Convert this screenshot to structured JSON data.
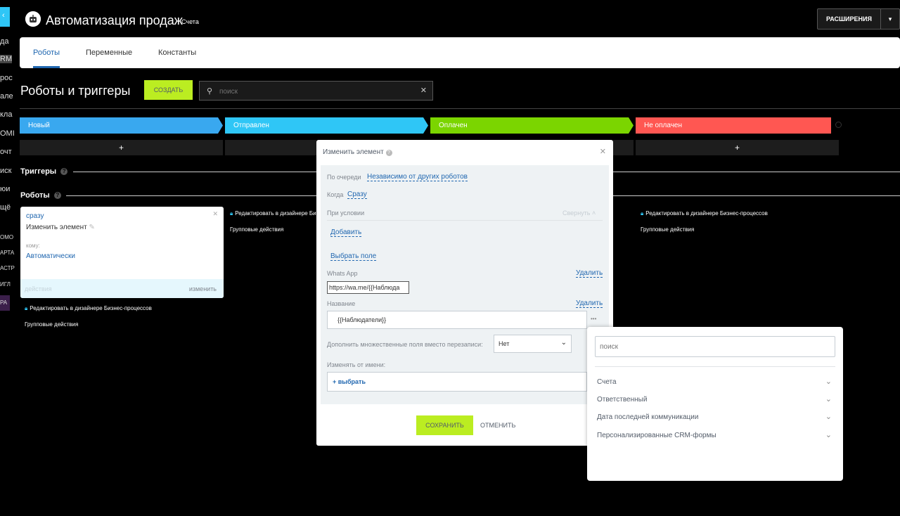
{
  "sidebar": {
    "items": [
      "да",
      "RM",
      "рос",
      "але",
      "кла",
      "ОМІ",
      "очт",
      "иск",
      "юи",
      "щё",
      "ОМО",
      "АРТА",
      "АСТР",
      "ИГЛ",
      "РА"
    ]
  },
  "header": {
    "title": "Автоматизация продаж",
    "subtitle": "Счета",
    "extensions_label": "РАСШИРЕНИЯ"
  },
  "tabs": [
    {
      "label": "Роботы"
    },
    {
      "label": "Переменные"
    },
    {
      "label": "Константы"
    }
  ],
  "page": {
    "title": "Роботы и триггеры",
    "create_label": "СОЗДАТЬ",
    "search_placeholder": "поиск"
  },
  "stages": [
    {
      "label": "Новый",
      "color": "#39a8ef"
    },
    {
      "label": "Отправлен",
      "color": "#2fc6f6"
    },
    {
      "label": "Оплачен",
      "color": "#7bd500"
    },
    {
      "label": "Не оплачен",
      "color": "#ff5752"
    }
  ],
  "sections": {
    "triggers": "Триггеры",
    "robots": "Роботы"
  },
  "robot_card": {
    "when": "сразу",
    "name": "Изменить элемент",
    "to_label": "кому:",
    "to_value": "Автоматически",
    "actions_label": "действия",
    "edit_label": "изменить"
  },
  "column_links": {
    "edit_designer": "Редактировать в дизайнере Бизнес-процессов",
    "group_actions": "Групповые действия",
    "edit_designer_truncated": "Редактировать в дизайнере Би"
  },
  "modal": {
    "title": "Изменить элемент",
    "order_label": "По очереди",
    "order_value": "Независимо от других роботов",
    "when_label": "Когда",
    "when_value": "Сразу",
    "condition_label": "При условии",
    "collapse_label": "Свернуть",
    "add_label": "Добавить",
    "choose_field_label": "Выбрать поле",
    "field1_label": "Whats App",
    "field1_value": "https://wa.me/{{Наблюда",
    "delete_label": "Удалить",
    "field2_label": "Название",
    "field2_value": "{{Наблюдатели}}",
    "more_label": "•••",
    "append_label": "Дополнить множественные поля вместо перезаписи:",
    "append_value": "Нет",
    "change_from_label": "Изменять от имени:",
    "choose_label": "+ выбрать",
    "save_label": "СОХРАНИТЬ",
    "cancel_label": "ОТМЕНИТЬ"
  },
  "popup": {
    "search_placeholder": "поиск",
    "items": [
      "Счета",
      "Ответственный",
      "Дата последней коммуникации",
      "Персонализированные CRM-формы"
    ]
  }
}
